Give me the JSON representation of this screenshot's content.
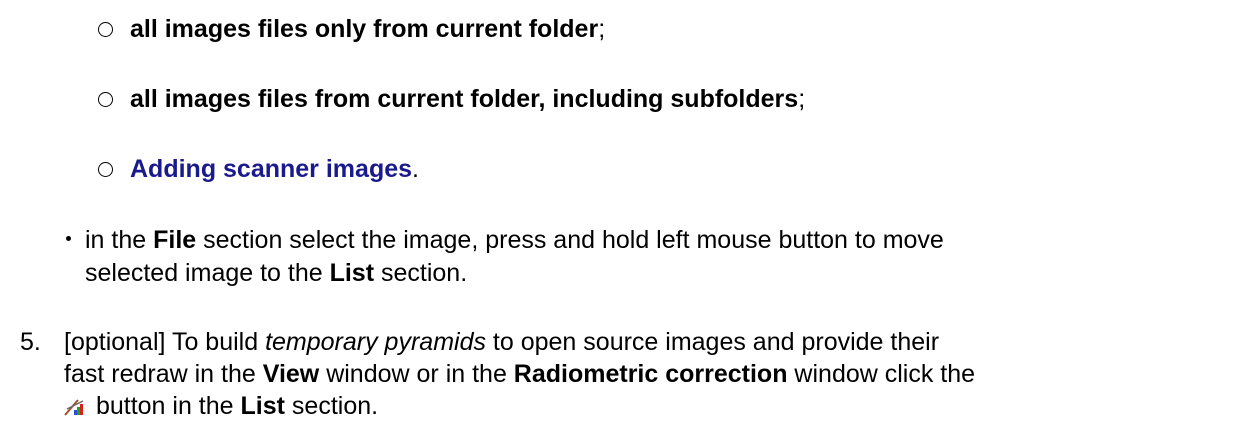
{
  "sub_items": [
    {
      "bold": "all images files only from current folder",
      "after": ";"
    },
    {
      "bold": "all images files from current folder, including subfolders",
      "after": ";"
    },
    {
      "link": "Adding scanner images",
      "after": "."
    }
  ],
  "bullet": {
    "t1": "in the ",
    "b1": "File",
    "t2": " section select the image, press and hold left mouse button to move",
    "t3": "selected image to the ",
    "b2": "List",
    "t4": " section."
  },
  "step5": {
    "number": "5.",
    "t1": "[optional] To build ",
    "i1": "temporary pyramids",
    "t2": " to open source images and provide their",
    "t3": "fast redraw in the ",
    "b1": "View",
    "t4": " window or in the ",
    "b2": "Radiometric correction",
    "t5": " window click the",
    "icon": "pyramid-build-icon",
    "t6": " button in the ",
    "b3": "List",
    "t7": " section."
  }
}
